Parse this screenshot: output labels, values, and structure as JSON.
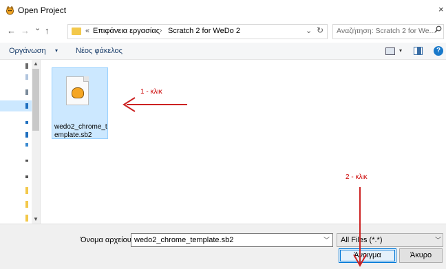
{
  "window": {
    "title": "Open Project",
    "close_glyph": "×"
  },
  "nav": {
    "back_glyph": "←",
    "forward_glyph": "→",
    "recent_glyph": "⌄",
    "up_glyph": "↑",
    "breadcrumb_prefix": "«",
    "breadcrumbs": [
      "Επιφάνεια εργασίας",
      "Scratch 2 for WeDo 2"
    ],
    "breadcrumb_separator": "›",
    "refresh_glyph": "↻",
    "search_placeholder": "Αναζήτηση: Scratch 2 for We...",
    "search_icon": "search-icon"
  },
  "toolbar": {
    "organize_label": "Οργάνωση",
    "new_folder_label": "Νέος φάκελος",
    "caret": "▾",
    "help_glyph": "?"
  },
  "files": [
    {
      "name": "wedo2_chrome_template.sb2",
      "icon": "scratch-file-icon",
      "selected": true
    }
  ],
  "annotations": {
    "step1": "1 - κλικ",
    "step2": "2 - κλικ",
    "arrow_color": "#cc2222"
  },
  "footer": {
    "filename_label": "Όνομα αρχείου:",
    "filename_value": "wedo2_chrome_template.sb2",
    "filetype_value": "All Files (*.*)",
    "open_label": "Άνοιγμα",
    "cancel_label": "Άκυρο"
  },
  "colors": {
    "selection": "#cce8ff",
    "accent": "#0078d7",
    "annotation": "#cc0000"
  }
}
